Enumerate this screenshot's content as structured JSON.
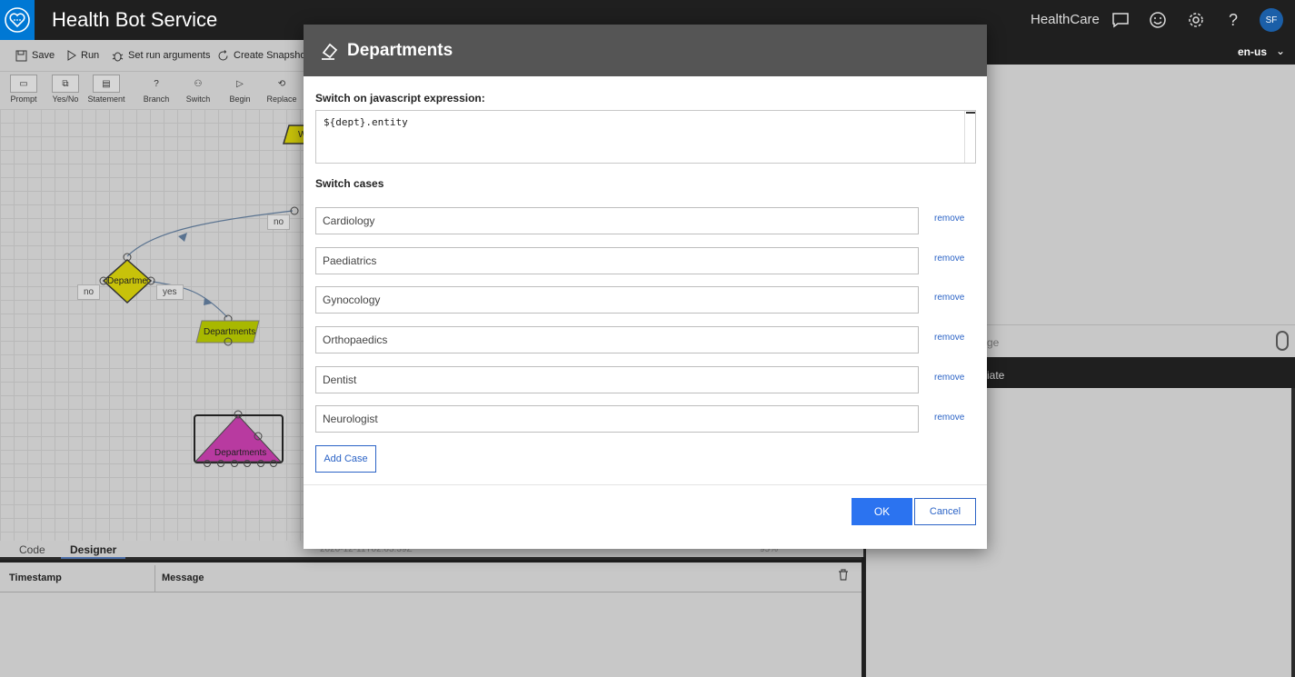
{
  "app": {
    "title": "Health Bot Service",
    "org": "HealthCare",
    "avatar_initials": "SF"
  },
  "toolbar": {
    "save": "Save",
    "run": "Run",
    "set_run_arguments": "Set run arguments",
    "create_snapshot": "Create Snapshot"
  },
  "shapes": [
    "Prompt",
    "Yes/No",
    "Statement",
    "Branch",
    "Switch",
    "Begin",
    "Replace"
  ],
  "chat": {
    "language": "en-us",
    "input_fragment": "ge",
    "bar_fragment": "iate"
  },
  "canvas": {
    "nodes": {
      "top_fragment": "W",
      "branch": "Departme",
      "statement": "Departments",
      "switch_node": "Departments"
    },
    "edges": {
      "no_top": "no",
      "no_left": "no",
      "yes": "yes"
    }
  },
  "bottom": {
    "tabs": {
      "code": "Code",
      "designer": "Designer"
    },
    "status_fragment": "2020-12-11T02:03:39Z",
    "zoom_fragment": "95%",
    "log_headers": {
      "timestamp": "Timestamp",
      "message": "Message"
    }
  },
  "modal": {
    "title": "Departments",
    "expression_label": "Switch on javascript expression:",
    "expression_value": "${dept}.entity",
    "cases_label": "Switch cases",
    "cases": [
      "Cardiology",
      "Paediatrics",
      "Gynocology",
      "Orthopaedics",
      "Dentist",
      "Neurologist"
    ],
    "remove_label": "remove",
    "add_case": "Add Case",
    "ok": "OK",
    "cancel": "Cancel"
  },
  "colors": {
    "accent": "#2b73f0",
    "link": "#2b63c6",
    "branch_node": "#c8c20a",
    "statement_node": "#a8b800",
    "switch_node": "#b83aa0",
    "topbar": "#1f1f1f",
    "modal_header": "#555555"
  }
}
